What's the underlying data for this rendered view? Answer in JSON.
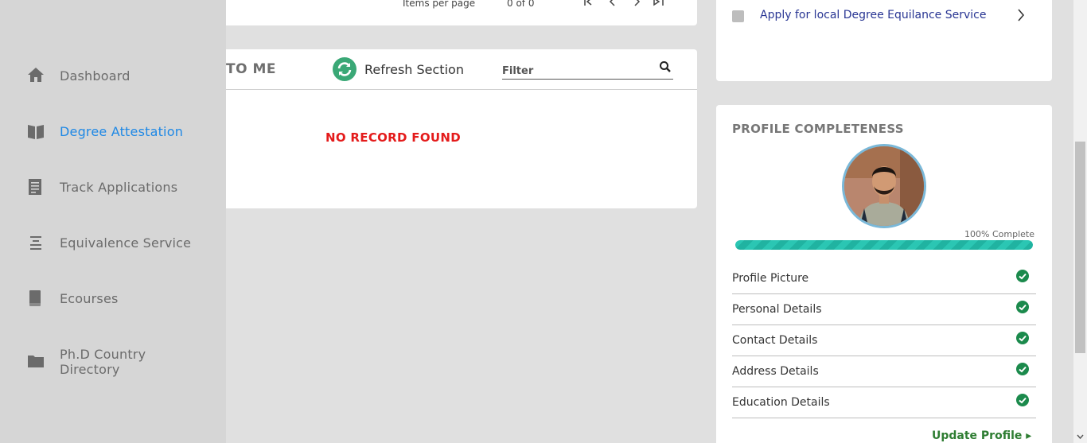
{
  "sidebar": {
    "items": [
      {
        "label": "Dashboard",
        "icon": "home-icon",
        "active": false
      },
      {
        "label": "Degree Attestation",
        "icon": "book-open-icon",
        "active": true
      },
      {
        "label": "Track Applications",
        "icon": "document-icon",
        "active": false
      },
      {
        "label": "Equivalence Service",
        "icon": "align-center-icon",
        "active": false
      },
      {
        "label": "Ecourses",
        "icon": "book-icon",
        "active": false
      },
      {
        "label": "Ph.D Country Directory",
        "icon": "folder-icon",
        "active": false
      }
    ]
  },
  "pager": {
    "items_per_page_label": "Items per page",
    "range": "0 of 0"
  },
  "list": {
    "section_title_partial": "TO ME",
    "refresh_label": "Refresh Section",
    "filter_placeholder": "Filter",
    "empty_message": "NO RECORD FOUND"
  },
  "apply": {
    "label": "Apply for local Degree Equilance Service"
  },
  "profile": {
    "title": "PROFILE COMPLETENESS",
    "percent_label": "100% Complete",
    "percent": 100,
    "items": [
      {
        "label": "Profile Picture",
        "complete": true
      },
      {
        "label": "Personal Details",
        "complete": true
      },
      {
        "label": "Contact Details",
        "complete": true
      },
      {
        "label": "Address Details",
        "complete": true
      },
      {
        "label": "Education Details",
        "complete": true
      }
    ],
    "update_label": "Update Profile ▸"
  },
  "colors": {
    "accent": "#1e88e5",
    "error": "#e41b1b",
    "success": "#2e7d32",
    "progress": "#2bc6b3",
    "link": "#283593"
  }
}
